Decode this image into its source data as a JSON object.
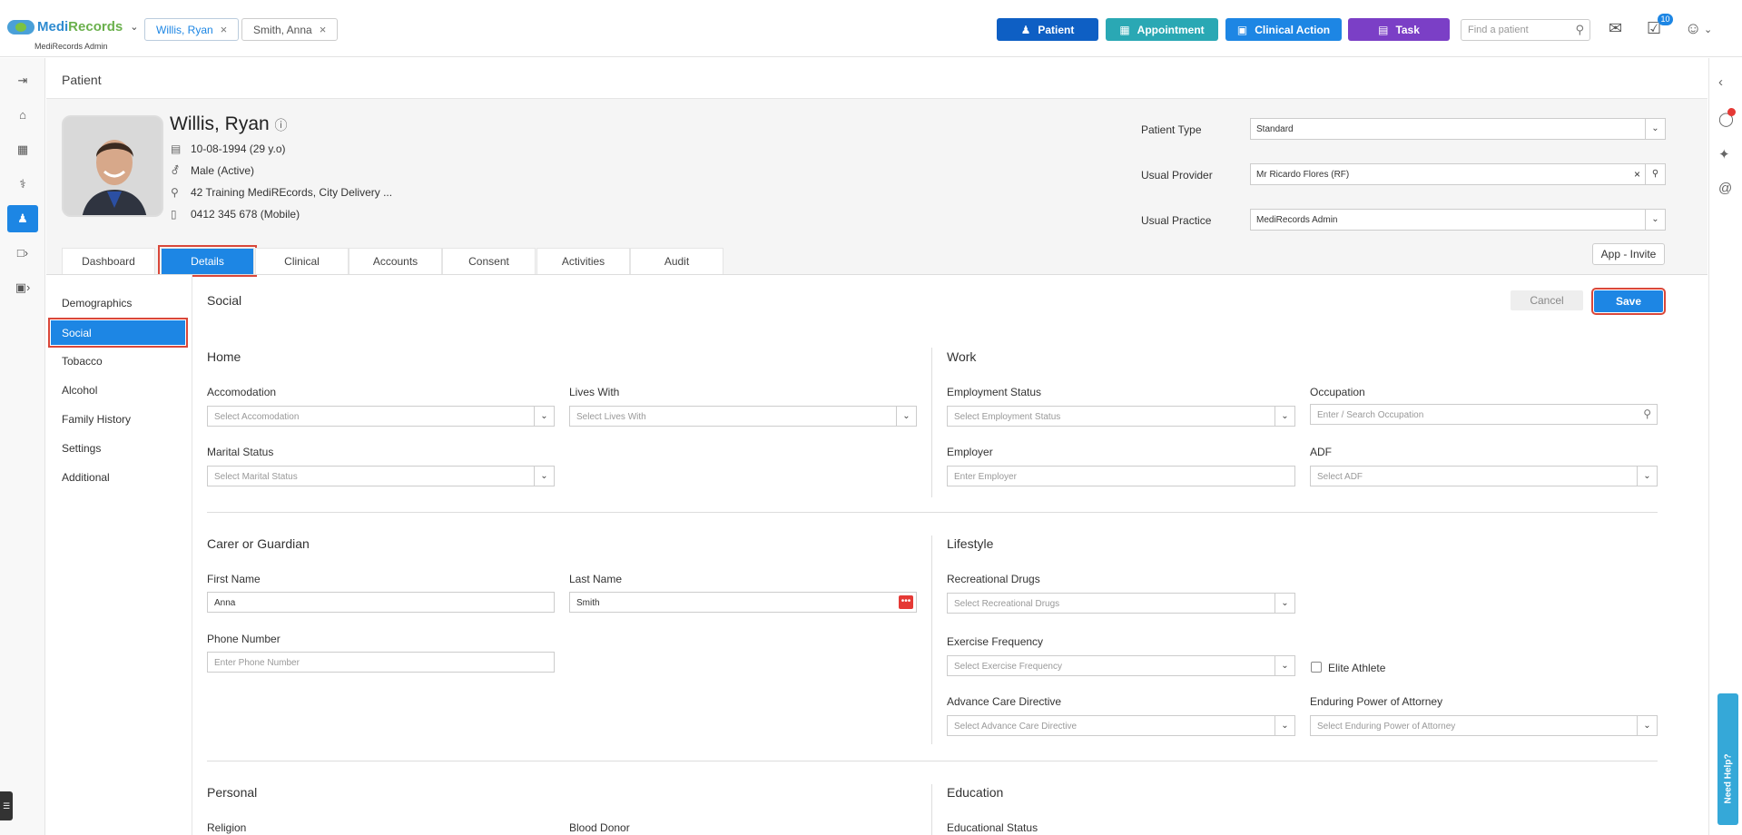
{
  "app": {
    "brand_a": "Medi",
    "brand_b": "Records",
    "subtitle": "MediRecords Admin"
  },
  "patient_tabs": [
    {
      "label": "Willis, Ryan"
    },
    {
      "label": "Smith, Anna"
    }
  ],
  "toolbar": {
    "patient_label": "Patient",
    "appointment_label": "Appointment",
    "clinical_action_label": "Clinical Action",
    "task_label": "Task",
    "search_placeholder": "Find a patient",
    "tasks_badge": "10",
    "colors": {
      "patient": "#0e5fc4",
      "appointment": "#2aa8b4",
      "clinical_action": "#1d86e4",
      "task": "#7b3fc6"
    }
  },
  "page": {
    "title": "Patient"
  },
  "patient": {
    "name": "Willis, Ryan",
    "dob": "10-08-1994 (29 y.o)",
    "gender": "Male (Active)",
    "address": "42 Training MediREcords, City Delivery ...",
    "phone": "0412 345 678 (Mobile)",
    "type_label": "Patient Type",
    "type_value": "Standard",
    "provider_label": "Usual Provider",
    "provider_value": "Mr Ricardo Flores (RF)",
    "practice_label": "Usual Practice",
    "practice_value": "MediRecords Admin",
    "app_invite": "App - Invite"
  },
  "tabs": [
    {
      "label": "Dashboard"
    },
    {
      "label": "Details"
    },
    {
      "label": "Clinical"
    },
    {
      "label": "Accounts"
    },
    {
      "label": "Consent"
    },
    {
      "label": "Activities"
    },
    {
      "label": "Audit"
    }
  ],
  "active_tab": "Details",
  "subnav": [
    {
      "label": "Demographics"
    },
    {
      "label": "Social"
    },
    {
      "label": "Tobacco"
    },
    {
      "label": "Alcohol"
    },
    {
      "label": "Family History"
    },
    {
      "label": "Settings"
    },
    {
      "label": "Additional"
    }
  ],
  "active_subnav": "Social",
  "form": {
    "title": "Social",
    "cancel": "Cancel",
    "save": "Save",
    "home": {
      "heading": "Home",
      "accomodation_label": "Accomodation",
      "accomodation_ph": "Select Accomodation",
      "lives_with_label": "Lives With",
      "lives_with_ph": "Select Lives With",
      "marital_label": "Marital Status",
      "marital_ph": "Select Marital Status"
    },
    "work": {
      "heading": "Work",
      "employment_label": "Employment Status",
      "employment_ph": "Select Employment Status",
      "occupation_label": "Occupation",
      "occupation_ph": "Enter / Search Occupation",
      "employer_label": "Employer",
      "employer_ph": "Enter Employer",
      "adf_label": "ADF",
      "adf_ph": "Select ADF"
    },
    "carer": {
      "heading": "Carer or Guardian",
      "first_label": "First Name",
      "first_value": "Anna",
      "last_label": "Last Name",
      "last_value": "Smith",
      "phone_label": "Phone Number",
      "phone_ph": "Enter Phone Number"
    },
    "lifestyle": {
      "heading": "Lifestyle",
      "drugs_label": "Recreational Drugs",
      "drugs_ph": "Select Recreational Drugs",
      "exercise_label": "Exercise Frequency",
      "exercise_ph": "Select Exercise Frequency",
      "elite_label": "Elite Athlete",
      "acd_label": "Advance Care Directive",
      "acd_ph": "Select Advance Care Directive",
      "epa_label": "Enduring Power of Attorney",
      "epa_ph": "Select Enduring Power of Attorney"
    },
    "personal": {
      "heading": "Personal",
      "religion_label": "Religion",
      "blood_label": "Blood Donor"
    },
    "education": {
      "heading": "Education",
      "status_label": "Educational Status"
    }
  },
  "help_tab": "Need Help?",
  "notif_badge": "1"
}
